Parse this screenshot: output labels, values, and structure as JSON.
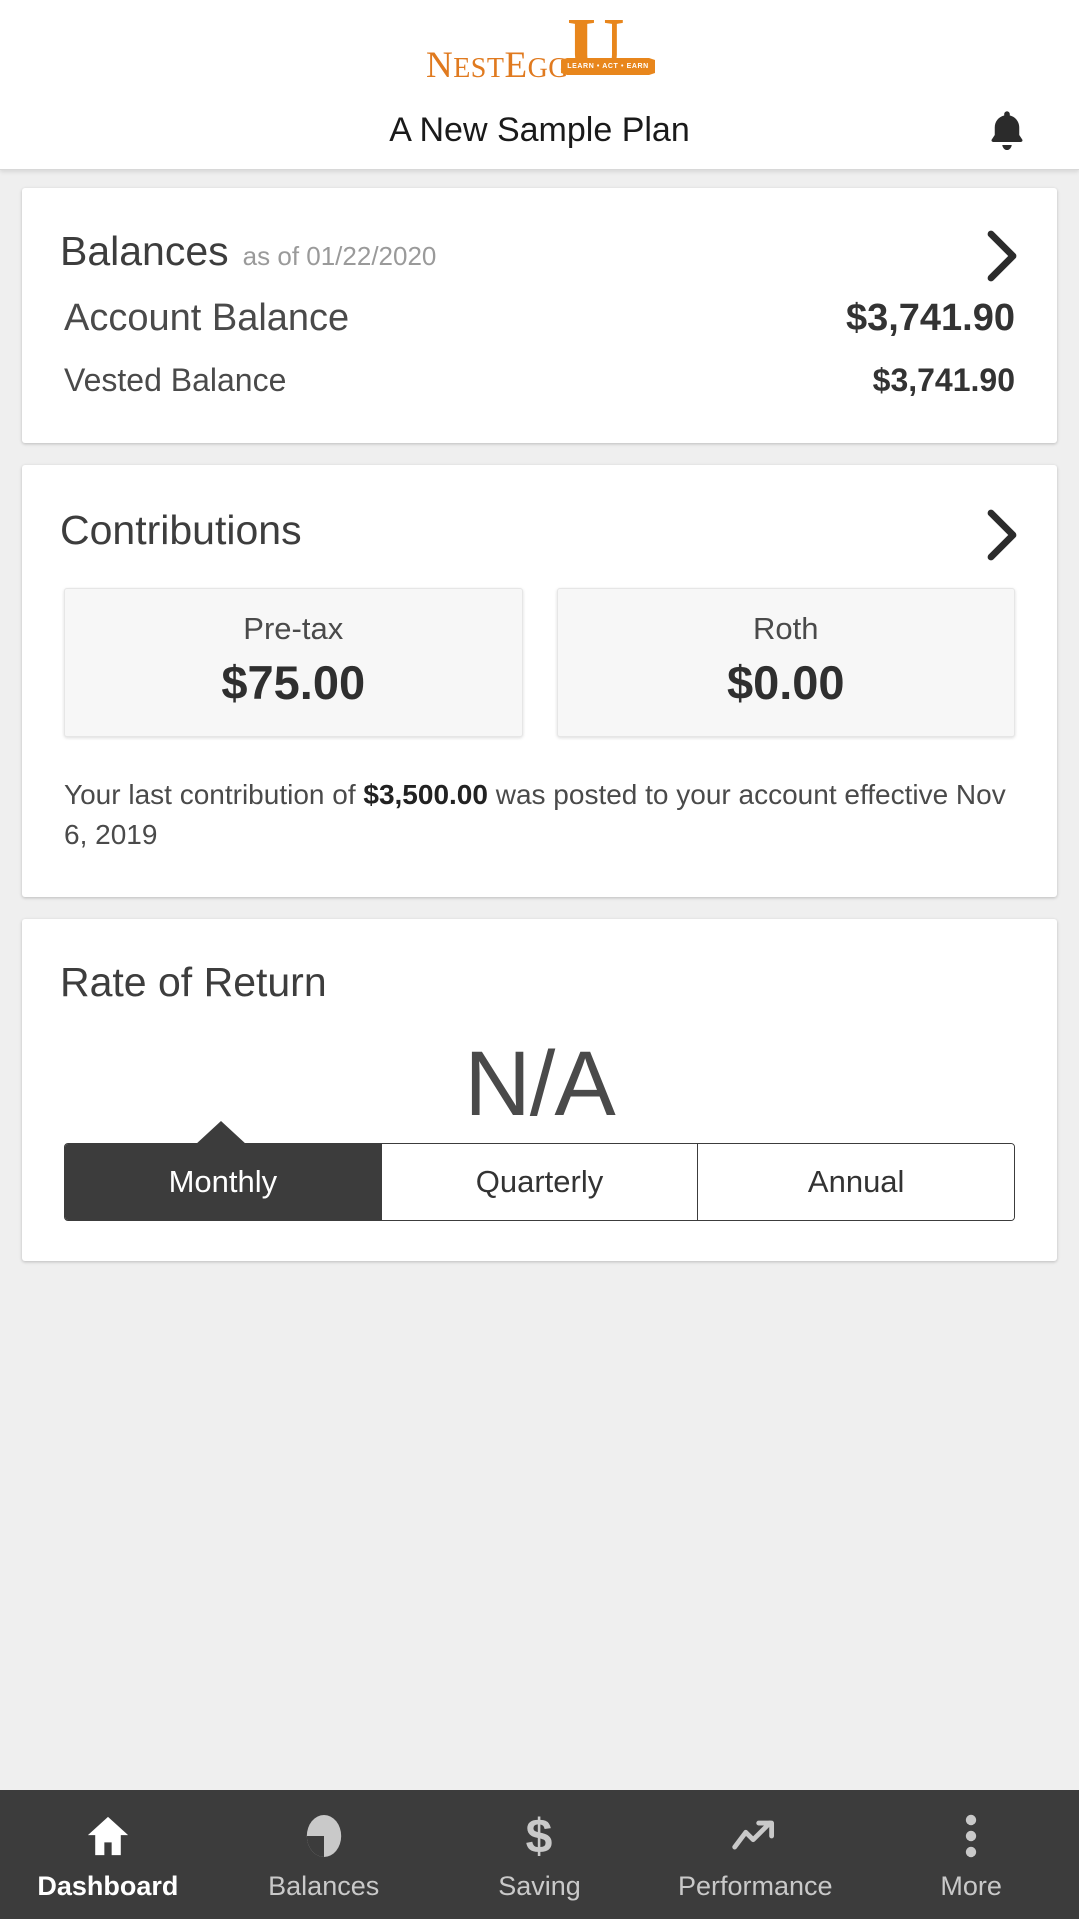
{
  "header": {
    "logo": {
      "text_main": "N",
      "text_rest": "EST",
      "text_egg": "E",
      "text_egg_rest": "GG",
      "full": "NestEgg",
      "u": "U",
      "banner": "LEARN • ACT • EARN",
      "color": "#E07A1F"
    },
    "plan_title": "A New Sample Plan",
    "bell_icon": "notification-bell-icon"
  },
  "balances_card": {
    "title": "Balances",
    "subtitle": "as of 01/22/2020",
    "chevron_icon": "chevron-right-icon",
    "rows": [
      {
        "label": "Account Balance",
        "value": "$3,741.90"
      },
      {
        "label": "Vested Balance",
        "value": "$3,741.90"
      }
    ]
  },
  "contributions_card": {
    "title": "Contributions",
    "chevron_icon": "chevron-right-icon",
    "tiles": [
      {
        "label": "Pre-tax",
        "value": "$75.00"
      },
      {
        "label": "Roth",
        "value": "$0.00"
      }
    ],
    "note_prefix": "Your last contribution of ",
    "note_amount": "$3,500.00",
    "note_suffix": " was posted to your account effective Nov 6, 2019"
  },
  "rate_of_return_card": {
    "title": "Rate of Return",
    "value": "N/A",
    "segments": [
      {
        "label": "Monthly",
        "active": true
      },
      {
        "label": "Quarterly",
        "active": false
      },
      {
        "label": "Annual",
        "active": false
      }
    ]
  },
  "bottom_nav": {
    "items": [
      {
        "label": "Dashboard",
        "icon": "home-icon",
        "active": true
      },
      {
        "label": "Balances",
        "icon": "pie-chart-icon",
        "active": false
      },
      {
        "label": "Saving",
        "icon": "dollar-sign-icon",
        "active": false
      },
      {
        "label": "Performance",
        "icon": "trend-up-icon",
        "active": false
      },
      {
        "label": "More",
        "icon": "more-vertical-icon",
        "active": false
      }
    ]
  }
}
